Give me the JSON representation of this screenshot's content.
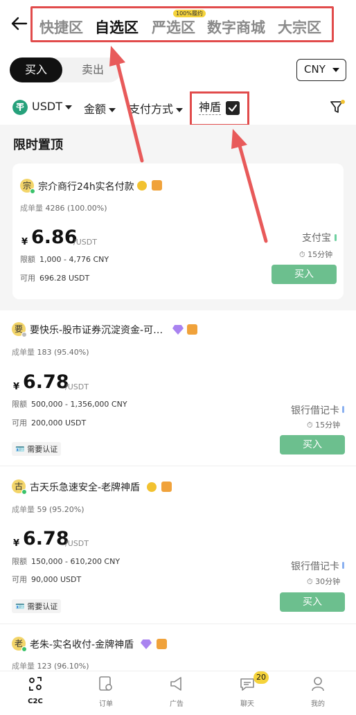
{
  "header": {
    "tabs": [
      {
        "label": "快捷区"
      },
      {
        "label": "自选区"
      },
      {
        "label": "严选区"
      },
      {
        "label": "数字商城"
      },
      {
        "label": "大宗区"
      }
    ],
    "tab_badge": "100%履约"
  },
  "trade": {
    "buy_label": "买入",
    "sell_label": "卖出",
    "currency": "CNY"
  },
  "filters": {
    "coin": "USDT",
    "amount": "金额",
    "payment": "支付方式",
    "shield": "神盾",
    "shield_checked": true
  },
  "pinned": {
    "title": "限时置顶"
  },
  "ads": [
    {
      "avatar": "宗",
      "name": "宗介商行24h实名付款",
      "orders_label": "成单量",
      "orders": "4286 (100.00%)",
      "currency_symbol": "¥",
      "price": "6.86",
      "unit": "/USDT",
      "limit_label": "限额",
      "limit": "1,000 - 4,776 CNY",
      "available_label": "可用",
      "available": "696.28 USDT",
      "payment": "支付宝",
      "time": "15分钟",
      "button": "买入"
    },
    {
      "avatar": "要",
      "name": "要快乐-股市证券沉淀资金-可…",
      "orders_label": "成单量",
      "orders": "183 (95.40%)",
      "currency_symbol": "¥",
      "price": "6.78",
      "unit": "/USDT",
      "limit_label": "限额",
      "limit": "500,000 - 1,356,000 CNY",
      "available_label": "可用",
      "available": "200,000 USDT",
      "payment": "银行借记卡",
      "time": "15分钟",
      "button": "买入",
      "verify": "需要认证"
    },
    {
      "avatar": "古",
      "name": "古天乐急速安全-老牌神盾",
      "orders_label": "成单量",
      "orders": "59 (95.20%)",
      "currency_symbol": "¥",
      "price": "6.78",
      "unit": "/USDT",
      "limit_label": "限额",
      "limit": "150,000 - 610,200 CNY",
      "available_label": "可用",
      "available": "90,000 USDT",
      "payment": "银行借记卡",
      "time": "30分钟",
      "button": "买入",
      "verify": "需要认证"
    },
    {
      "avatar": "老",
      "name": "老朱-实名收付-金牌神盾",
      "orders_label": "成单量",
      "orders": "123 (96.10%)"
    }
  ],
  "bottom_nav": [
    {
      "label": "C2C"
    },
    {
      "label": "订单"
    },
    {
      "label": "广告"
    },
    {
      "label": "聊天",
      "badge": "20"
    },
    {
      "label": "我的"
    }
  ],
  "colors": {
    "accent_green": "#6cbf8e",
    "highlight_red": "#e14b4b",
    "badge_yellow": "#f5d33b"
  }
}
